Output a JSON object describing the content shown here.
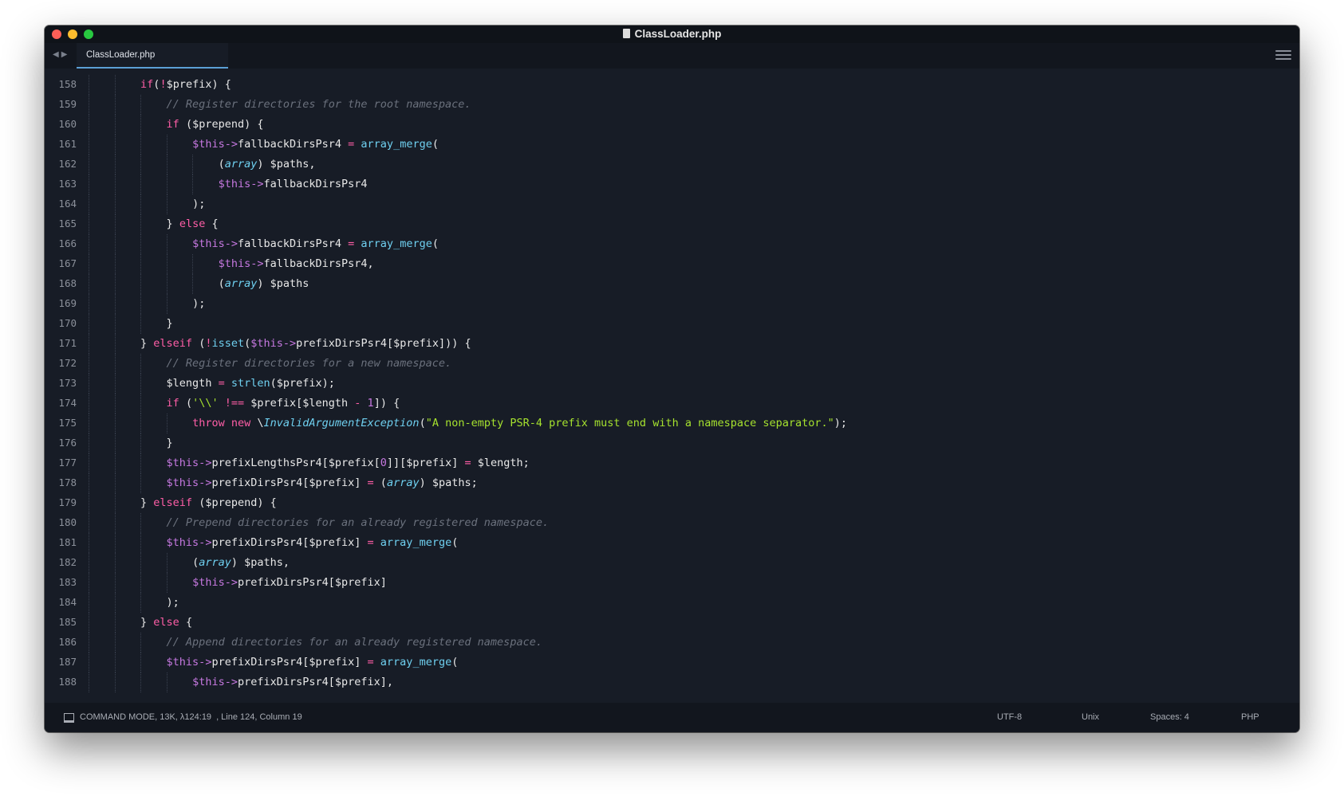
{
  "window": {
    "title": "ClassLoader.php"
  },
  "tabs": [
    {
      "label": "ClassLoader.php"
    }
  ],
  "editor": {
    "lines": [
      {
        "num": "158",
        "indent": 2,
        "tokens": [
          [
            "kw",
            "if"
          ],
          [
            "",
            "("
          ],
          [
            "op",
            "!"
          ],
          [
            "",
            "$prefix) {"
          ]
        ]
      },
      {
        "num": "159",
        "indent": 3,
        "tokens": [
          [
            "cm",
            "// Register directories for the root namespace."
          ]
        ]
      },
      {
        "num": "160",
        "indent": 3,
        "tokens": [
          [
            "kw",
            "if"
          ],
          [
            "",
            " ($prepend) {"
          ]
        ]
      },
      {
        "num": "161",
        "indent": 4,
        "tokens": [
          [
            "var",
            "$this->"
          ],
          [
            "",
            "fallbackDirsPsr4 "
          ],
          [
            "op",
            "="
          ],
          [
            "fn",
            " array_merge"
          ],
          [
            "",
            "("
          ]
        ]
      },
      {
        "num": "162",
        "indent": 5,
        "tokens": [
          [
            "",
            "("
          ],
          [
            "ty",
            "array"
          ],
          [
            "",
            ") $paths,"
          ]
        ]
      },
      {
        "num": "163",
        "indent": 5,
        "tokens": [
          [
            "var",
            "$this->"
          ],
          [
            "",
            "fallbackDirsPsr4"
          ]
        ]
      },
      {
        "num": "164",
        "indent": 4,
        "tokens": [
          [
            "",
            ");"
          ]
        ]
      },
      {
        "num": "165",
        "indent": 3,
        "tokens": [
          [
            "",
            "} "
          ],
          [
            "kw",
            "else"
          ],
          [
            "",
            " {"
          ]
        ]
      },
      {
        "num": "166",
        "indent": 4,
        "tokens": [
          [
            "var",
            "$this->"
          ],
          [
            "",
            "fallbackDirsPsr4 "
          ],
          [
            "op",
            "="
          ],
          [
            "fn",
            " array_merge"
          ],
          [
            "",
            "("
          ]
        ]
      },
      {
        "num": "167",
        "indent": 5,
        "tokens": [
          [
            "var",
            "$this->"
          ],
          [
            "",
            "fallbackDirsPsr4,"
          ]
        ]
      },
      {
        "num": "168",
        "indent": 5,
        "tokens": [
          [
            "",
            "("
          ],
          [
            "ty",
            "array"
          ],
          [
            "",
            ") $paths"
          ]
        ]
      },
      {
        "num": "169",
        "indent": 4,
        "tokens": [
          [
            "",
            ");"
          ]
        ]
      },
      {
        "num": "170",
        "indent": 3,
        "tokens": [
          [
            "",
            "}"
          ]
        ]
      },
      {
        "num": "171",
        "indent": 2,
        "tokens": [
          [
            "",
            "} "
          ],
          [
            "kw",
            "elseif"
          ],
          [
            "",
            " ("
          ],
          [
            "op",
            "!"
          ],
          [
            "fn",
            "isset"
          ],
          [
            "",
            "("
          ],
          [
            "var",
            "$this->"
          ],
          [
            "",
            "prefixDirsPsr4[$prefix])) {"
          ]
        ]
      },
      {
        "num": "172",
        "indent": 3,
        "tokens": [
          [
            "cm",
            "// Register directories for a new namespace."
          ]
        ]
      },
      {
        "num": "173",
        "indent": 3,
        "tokens": [
          [
            "",
            "$length "
          ],
          [
            "op",
            "="
          ],
          [
            "fn",
            " strlen"
          ],
          [
            "",
            "($prefix);"
          ]
        ]
      },
      {
        "num": "174",
        "indent": 3,
        "tokens": [
          [
            "kw",
            "if"
          ],
          [
            "",
            " ("
          ],
          [
            "str",
            "'\\\\'"
          ],
          [
            "op",
            " !=="
          ],
          [
            "",
            " $prefix[$length "
          ],
          [
            "op",
            "-"
          ],
          [
            "num",
            " 1"
          ],
          [
            "",
            "]) {"
          ]
        ]
      },
      {
        "num": "175",
        "indent": 4,
        "tokens": [
          [
            "kw",
            "throw new"
          ],
          [
            "",
            " \\"
          ],
          [
            "ty",
            "InvalidArgumentException"
          ],
          [
            "",
            "("
          ],
          [
            "str",
            "\"A non-empty PSR-4 prefix must end with a namespace separator.\""
          ],
          [
            "",
            ");"
          ]
        ]
      },
      {
        "num": "176",
        "indent": 3,
        "tokens": [
          [
            "",
            "}"
          ]
        ]
      },
      {
        "num": "177",
        "indent": 3,
        "tokens": [
          [
            "var",
            "$this->"
          ],
          [
            "",
            "prefixLengthsPsr4[$prefix["
          ],
          [
            "num",
            "0"
          ],
          [
            "",
            "]][$prefix] "
          ],
          [
            "op",
            "="
          ],
          [
            "",
            " $length;"
          ]
        ]
      },
      {
        "num": "178",
        "indent": 3,
        "tokens": [
          [
            "var",
            "$this->"
          ],
          [
            "",
            "prefixDirsPsr4[$prefix] "
          ],
          [
            "op",
            "="
          ],
          [
            "",
            " ("
          ],
          [
            "ty",
            "array"
          ],
          [
            "",
            ") $paths;"
          ]
        ]
      },
      {
        "num": "179",
        "indent": 2,
        "tokens": [
          [
            "",
            "} "
          ],
          [
            "kw",
            "elseif"
          ],
          [
            "",
            " ($prepend) {"
          ]
        ]
      },
      {
        "num": "180",
        "indent": 3,
        "tokens": [
          [
            "cm",
            "// Prepend directories for an already registered namespace."
          ]
        ]
      },
      {
        "num": "181",
        "indent": 3,
        "tokens": [
          [
            "var",
            "$this->"
          ],
          [
            "",
            "prefixDirsPsr4[$prefix] "
          ],
          [
            "op",
            "="
          ],
          [
            "fn",
            " array_merge"
          ],
          [
            "",
            "("
          ]
        ]
      },
      {
        "num": "182",
        "indent": 4,
        "tokens": [
          [
            "",
            "("
          ],
          [
            "ty",
            "array"
          ],
          [
            "",
            ") $paths,"
          ]
        ]
      },
      {
        "num": "183",
        "indent": 4,
        "tokens": [
          [
            "var",
            "$this->"
          ],
          [
            "",
            "prefixDirsPsr4[$prefix]"
          ]
        ]
      },
      {
        "num": "184",
        "indent": 3,
        "tokens": [
          [
            "",
            ");"
          ]
        ]
      },
      {
        "num": "185",
        "indent": 2,
        "tokens": [
          [
            "",
            "} "
          ],
          [
            "kw",
            "else"
          ],
          [
            "",
            " {"
          ]
        ]
      },
      {
        "num": "186",
        "indent": 3,
        "tokens": [
          [
            "cm",
            "// Append directories for an already registered namespace."
          ]
        ]
      },
      {
        "num": "187",
        "indent": 3,
        "tokens": [
          [
            "var",
            "$this->"
          ],
          [
            "",
            "prefixDirsPsr4[$prefix] "
          ],
          [
            "op",
            "="
          ],
          [
            "fn",
            " array_merge"
          ],
          [
            "",
            "("
          ]
        ]
      },
      {
        "num": "188",
        "indent": 4,
        "tokens": [
          [
            "var",
            "$this->"
          ],
          [
            "",
            "prefixDirsPsr4[$prefix],"
          ]
        ]
      }
    ]
  },
  "statusbar": {
    "mode": "COMMAND MODE, 13K, λ124:19",
    "position": ", Line 124, Column 19",
    "encoding": "UTF-8",
    "line_endings": "Unix",
    "indentation": "Spaces: 4",
    "syntax": "PHP"
  },
  "colors": {
    "background": "#171c26",
    "keyword": "#ff5ea7",
    "variable": "#c678e0",
    "function": "#6fd0f0",
    "string": "#a6e22e",
    "comment": "#6b717d"
  }
}
